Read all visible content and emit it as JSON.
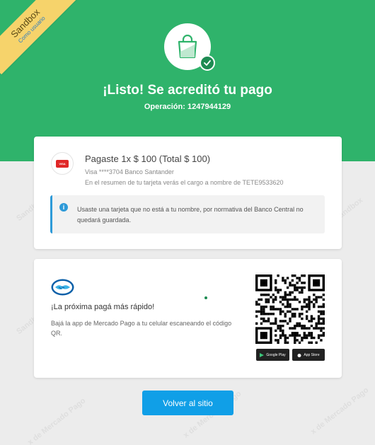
{
  "sandbox": {
    "label": "Sandbox",
    "sublabel": "Como usuario"
  },
  "hero": {
    "title": "¡Listo! Se acreditó tu pago",
    "operation": "Operación: 1247944129"
  },
  "payment": {
    "title": "Pagaste 1x $ 100 (Total $ 100)",
    "card_line": "Visa ****3704 Banco Santander",
    "statement_line": "En el resumen de tu tarjeta verás el cargo a nombre de TETE9533620",
    "card_brand": "VISA"
  },
  "notice": {
    "icon": "info-icon",
    "text": "Usaste una tarjeta que no está a tu nombre, por normativa del Banco Central no quedará guardada."
  },
  "promo": {
    "title": "¡La próxima pagá más rápido!",
    "text": "Bajá la app de Mercado Pago a tu celular escaneando el código QR.",
    "google_play": "Google Play",
    "app_store": "App Store"
  },
  "actions": {
    "back_label": "Volver al sitio"
  },
  "colors": {
    "hero_green": "#2fb36b",
    "check_green": "#1d8b52",
    "primary_blue": "#109fe7",
    "info_blue": "#2e9ad8",
    "sandbox_yellow": "#f6d36b"
  }
}
